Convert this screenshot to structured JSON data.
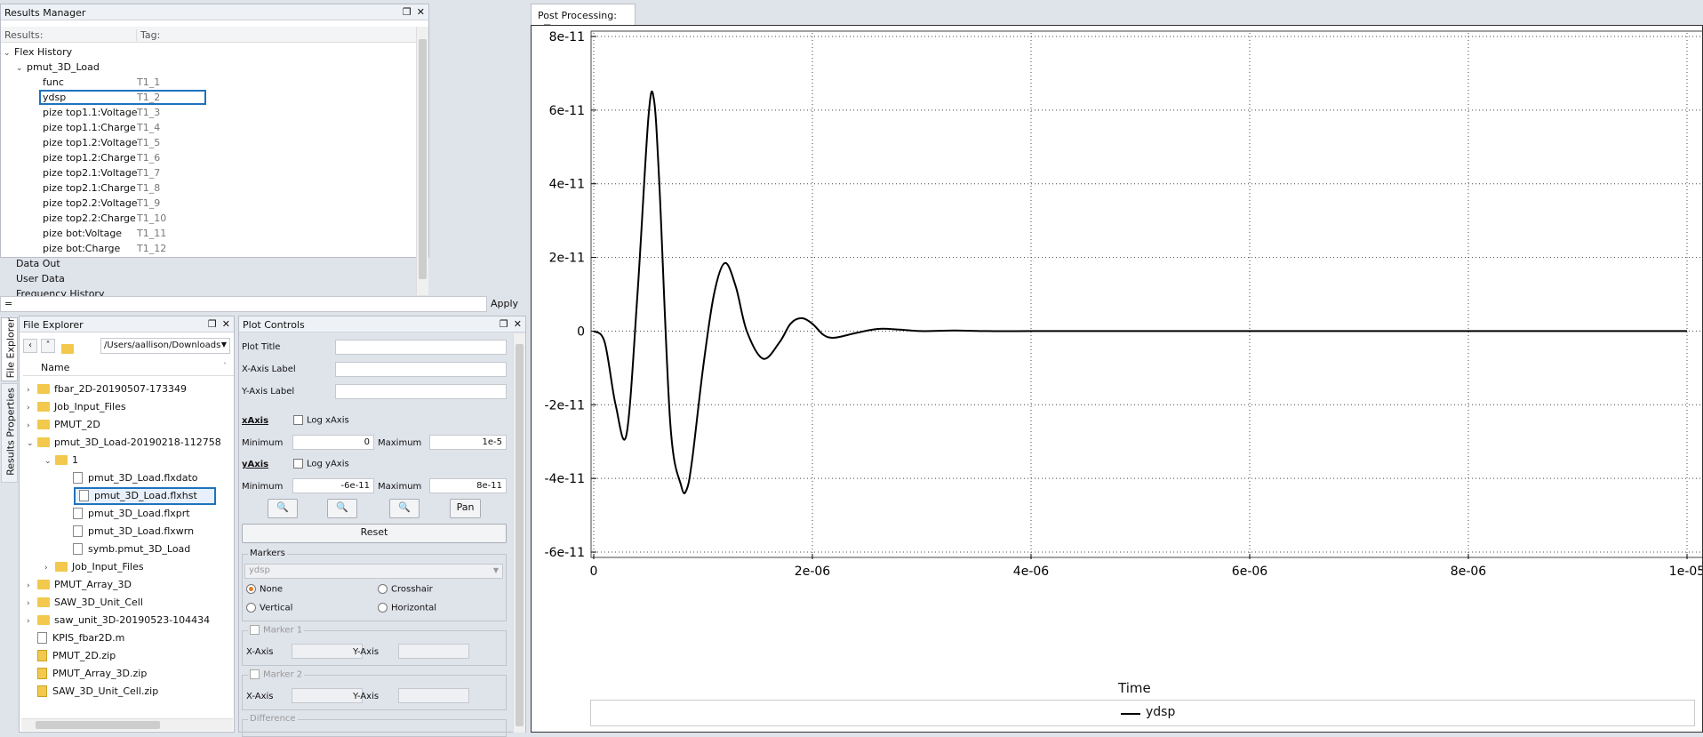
{
  "results_manager": {
    "title": "Results Manager",
    "col_results": "Results:",
    "col_tag": "Tag:",
    "root": "Flex History",
    "model": "pmut_3D_Load",
    "items": [
      {
        "name": "func",
        "tag": "T1_1"
      },
      {
        "name": "ydsp",
        "tag": "T1_2"
      },
      {
        "name": "pize top1.1:Voltage",
        "tag": "T1_3"
      },
      {
        "name": "pize top1.1:Charge",
        "tag": "T1_4"
      },
      {
        "name": "pize top1.2:Voltage",
        "tag": "T1_5"
      },
      {
        "name": "pize top1.2:Charge",
        "tag": "T1_6"
      },
      {
        "name": "pize top2.1:Voltage",
        "tag": "T1_7"
      },
      {
        "name": "pize top2.1:Charge",
        "tag": "T1_8"
      },
      {
        "name": "pize top2.2:Voltage",
        "tag": "T1_9"
      },
      {
        "name": "pize top2.2:Charge",
        "tag": "T1_10"
      },
      {
        "name": "pize bot:Voltage",
        "tag": "T1_11"
      },
      {
        "name": "pize bot:Charge",
        "tag": "T1_12"
      }
    ],
    "other": [
      "Data Out",
      "User Data",
      "Frequency History"
    ],
    "filter_value": "=",
    "apply_label": "Apply"
  },
  "side_tabs": {
    "file_explorer": "File Explorer",
    "results_properties": "Results Properties"
  },
  "file_explorer": {
    "title": "File Explorer",
    "path": "/Users/aallison/Downloads",
    "col_name": "Name",
    "rows": [
      {
        "label": "fbar_2D-20190507-173349",
        "kind": "folder"
      },
      {
        "label": "Job_Input_Files",
        "kind": "folder"
      },
      {
        "label": "PMUT_2D",
        "kind": "folder"
      },
      {
        "label": "pmut_3D_Load-20190218-112758",
        "kind": "folder"
      },
      {
        "label": "1",
        "kind": "folder"
      },
      {
        "label": "pmut_3D_Load.flxdato",
        "kind": "file"
      },
      {
        "label": "pmut_3D_Load.flxhst",
        "kind": "file"
      },
      {
        "label": "pmut_3D_Load.flxprt",
        "kind": "file"
      },
      {
        "label": "pmut_3D_Load.flxwrn",
        "kind": "file"
      },
      {
        "label": "symb.pmut_3D_Load",
        "kind": "file"
      },
      {
        "label": "Job_Input_Files",
        "kind": "folder"
      },
      {
        "label": "PMUT_Array_3D",
        "kind": "folder"
      },
      {
        "label": "SAW_3D_Unit_Cell",
        "kind": "folder"
      },
      {
        "label": "saw_unit_3D-20190523-104434",
        "kind": "folder"
      },
      {
        "label": "KPIS_fbar2D.m",
        "kind": "file"
      },
      {
        "label": "PMUT_2D.zip",
        "kind": "zip"
      },
      {
        "label": "PMUT_Array_3D.zip",
        "kind": "zip"
      },
      {
        "label": "SAW_3D_Unit_Cell.zip",
        "kind": "zip"
      }
    ]
  },
  "plot_controls": {
    "title": "Plot Controls",
    "plot_title_label": "Plot Title",
    "xaxis_label_label": "X-Axis Label",
    "yaxis_label_label": "Y-Axis Label",
    "xaxis": "xAxis",
    "log_x": "Log xAxis",
    "yaxis": "yAxis",
    "log_y": "Log yAxis",
    "minimum": "Minimum",
    "maximum": "Maximum",
    "x_min": "0",
    "x_max": "1e-5",
    "y_min": "-6e-11",
    "y_max": "8e-11",
    "pan": "Pan",
    "reset": "Reset",
    "markers": "Markers",
    "marker_select": "ydsp",
    "none": "None",
    "crosshair": "Crosshair",
    "vertical": "Vertical",
    "horizontal": "Horizontal",
    "marker1": "Marker 1",
    "marker2": "Marker 2",
    "x_axis": "X-Axis",
    "y_axis": "Y-Axis",
    "difference": "Difference"
  },
  "post_processing": {
    "tab": "Post Processing:",
    "close": "⊠"
  },
  "chart_data": {
    "type": "line",
    "xlabel": "Time",
    "ylabel": "",
    "xlim": [
      0,
      1e-05
    ],
    "ylim": [
      -6e-11,
      8e-11
    ],
    "x_ticks": [
      "0",
      "2e-06",
      "4e-06",
      "6e-06",
      "8e-06",
      "1e-05"
    ],
    "y_ticks": [
      "8e-11",
      "6e-11",
      "4e-11",
      "2e-11",
      "0",
      "-2e-11",
      "-4e-11",
      "-6e-11"
    ],
    "grid": true,
    "legend": "bottom-center",
    "series": [
      {
        "name": "ydsp",
        "color": "#000000",
        "x": [
          0,
          1e-07,
          2e-07,
          3e-07,
          4e-07,
          5e-07,
          5.5e-07,
          6e-07,
          7e-07,
          8e-07,
          8.5e-07,
          9e-07,
          1e-06,
          1.1e-06,
          1.2e-06,
          1.3e-06,
          1.4e-06,
          1.55e-06,
          1.7e-06,
          1.8e-06,
          1.9e-06,
          2e-06,
          2.1e-06,
          2.2e-06,
          2.4e-06,
          2.6e-06,
          2.8e-06,
          3e-06,
          3.3e-06,
          3.6e-06,
          4e-06,
          6e-06,
          8e-06,
          1e-05
        ],
        "y": [
          0,
          -3e-12,
          -2e-11,
          -2.8e-11,
          1e-11,
          5.8e-11,
          6.3e-11,
          4e-11,
          -2.5e-11,
          -4.2e-11,
          -4.3e-11,
          -3.5e-11,
          -1e-11,
          1e-11,
          1.85e-11,
          1.2e-11,
          0,
          -7.5e-12,
          -3e-12,
          2e-12,
          3.5e-12,
          2e-12,
          -1e-12,
          -1.8e-12,
          -5e-13,
          6e-13,
          4e-13,
          0,
          1.5e-13,
          0,
          0,
          0,
          0,
          0
        ]
      }
    ]
  }
}
